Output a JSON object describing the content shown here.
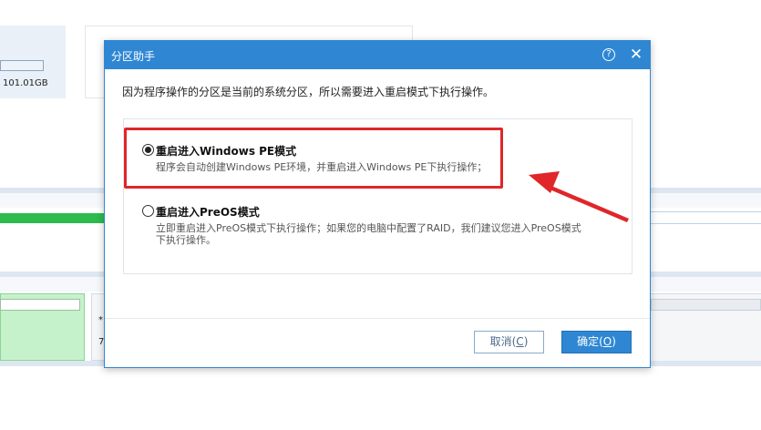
{
  "background": {
    "disk_size": "101.01GB",
    "panel_text_1": "*",
    "panel_text_2": "7"
  },
  "dialog": {
    "title": "分区助手",
    "help_symbol": "?",
    "close_symbol": "✕",
    "message": "因为程序操作的分区是当前的系统分区，所以需要进入重启模式下执行操作。",
    "options": [
      {
        "title": "重启进入Windows PE模式",
        "desc": "程序会自动创建Windows PE环境，并重启进入Windows PE下执行操作；",
        "selected": true
      },
      {
        "title": "重启进入PreOS模式",
        "desc": "立即重启进入PreOS模式下执行操作；如果您的电脑中配置了RAID，我们建议您进入PreOS模式下执行操作。",
        "selected": false
      }
    ],
    "buttons": {
      "cancel_label": "取消(",
      "cancel_key": "C",
      "cancel_close": ")",
      "ok_label": "确定(",
      "ok_key": "O",
      "ok_close": ")"
    }
  },
  "colors": {
    "accent": "#2f87d3",
    "highlight": "#e0262a",
    "progress_green": "#2dbb4d"
  }
}
